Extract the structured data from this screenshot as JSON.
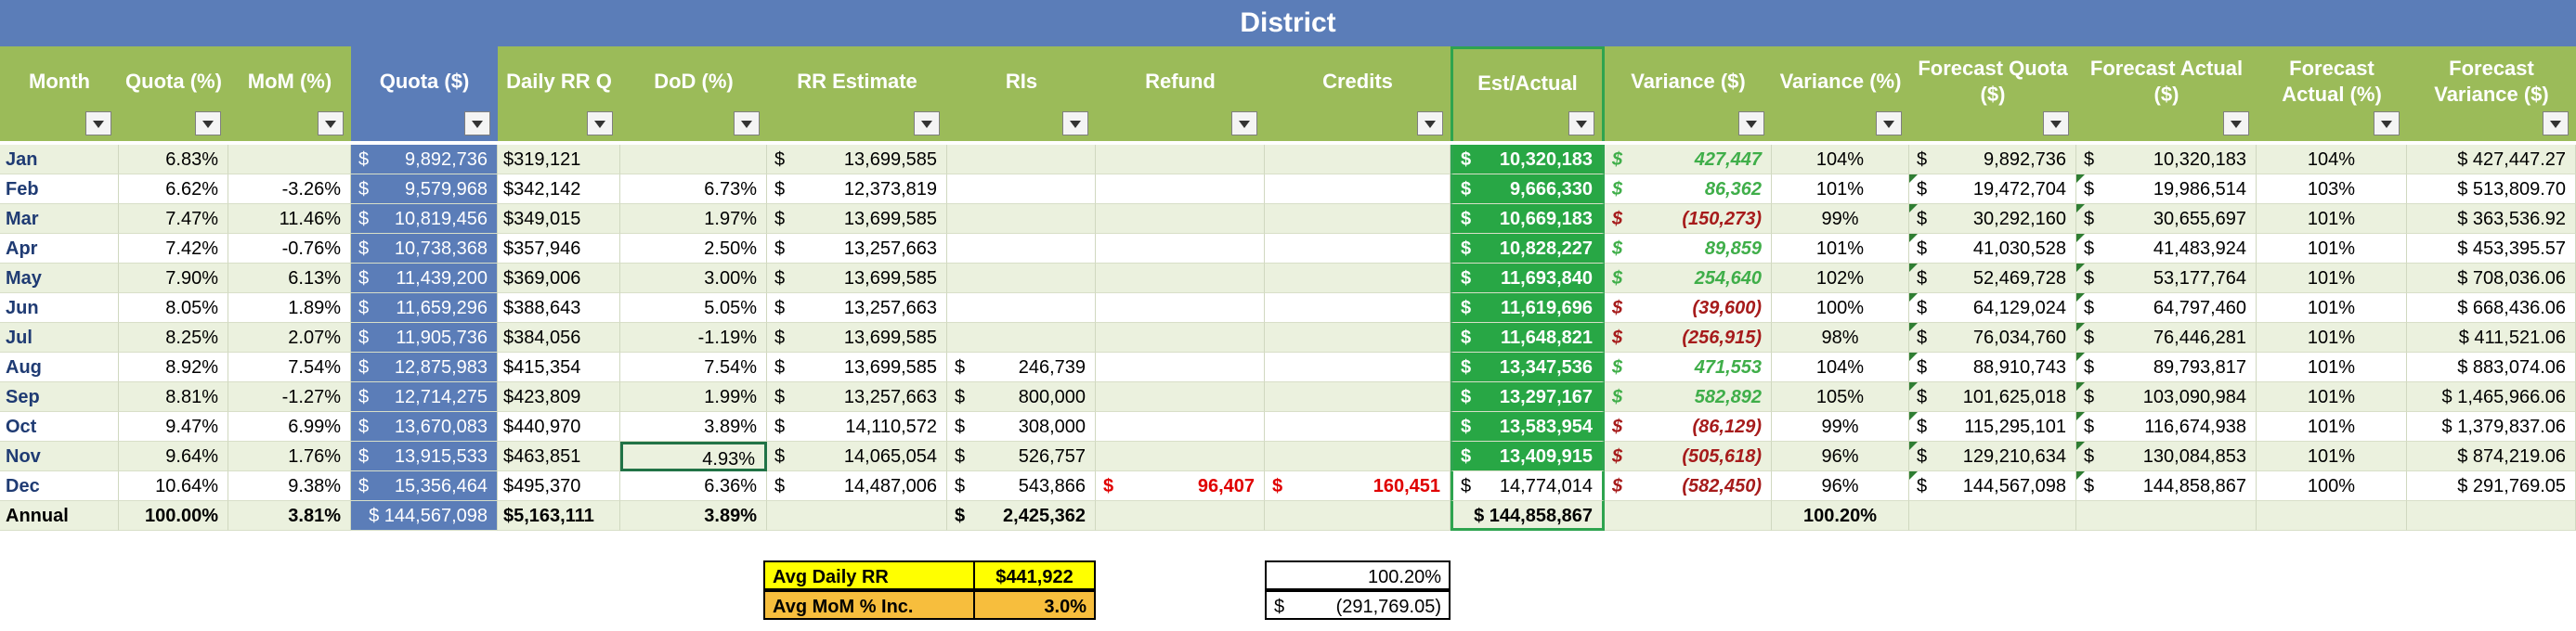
{
  "title": "District",
  "headers": {
    "month": "Month",
    "quota_pct": "Quota (%)",
    "mom": "MoM  (%)",
    "quota_dollar": "Quota ($)",
    "daily_rr": "Daily RR Q",
    "dod": "DoD (%)",
    "rr_estimate": "RR Estimate",
    "ris": "RIs",
    "refund": "Refund",
    "credits": "Credits",
    "est_actual": "Est/Actual",
    "variance_dollar": "Variance ($)",
    "variance_pct": "Variance (%)",
    "forecast_quota": "Forecast Quota ($)",
    "forecast_actual": "Forecast Actual ($)",
    "forecast_actual_pct": "Forecast Actual (%)",
    "forecast_variance": "Forecast Variance ($)"
  },
  "rows": [
    {
      "month": "Jan",
      "qp": "6.83%",
      "mom": "",
      "qd": "9,892,736",
      "drr": "$319,121",
      "dod": "",
      "rre": "13,699,585",
      "ris": "",
      "ref": "",
      "cred": "",
      "est": "10,320,183",
      "var": "427,447",
      "varneg": false,
      "vp": "104%",
      "fq": "9,892,736",
      "fa": "10,320,183",
      "fap": "104%",
      "fv": "$ 427,447.27"
    },
    {
      "month": "Feb",
      "qp": "6.62%",
      "mom": "-3.26%",
      "qd": "9,579,968",
      "drr": "$342,142",
      "dod": "6.73%",
      "rre": "12,373,819",
      "ris": "",
      "ref": "",
      "cred": "",
      "est": "9,666,330",
      "var": "86,362",
      "varneg": false,
      "vp": "101%",
      "fq": "19,472,704",
      "fa": "19,986,514",
      "fap": "103%",
      "fv": "$ 513,809.70"
    },
    {
      "month": "Mar",
      "qp": "7.47%",
      "mom": "11.46%",
      "qd": "10,819,456",
      "drr": "$349,015",
      "dod": "1.97%",
      "rre": "13,699,585",
      "ris": "",
      "ref": "",
      "cred": "",
      "est": "10,669,183",
      "var": "(150,273)",
      "varneg": true,
      "vp": "99%",
      "fq": "30,292,160",
      "fa": "30,655,697",
      "fap": "101%",
      "fv": "$ 363,536.92"
    },
    {
      "month": "Apr",
      "qp": "7.42%",
      "mom": "-0.76%",
      "qd": "10,738,368",
      "drr": "$357,946",
      "dod": "2.50%",
      "rre": "13,257,663",
      "ris": "",
      "ref": "",
      "cred": "",
      "est": "10,828,227",
      "var": "89,859",
      "varneg": false,
      "vp": "101%",
      "fq": "41,030,528",
      "fa": "41,483,924",
      "fap": "101%",
      "fv": "$ 453,395.57"
    },
    {
      "month": "May",
      "qp": "7.90%",
      "mom": "6.13%",
      "qd": "11,439,200",
      "drr": "$369,006",
      "dod": "3.00%",
      "rre": "13,699,585",
      "ris": "",
      "ref": "",
      "cred": "",
      "est": "11,693,840",
      "var": "254,640",
      "varneg": false,
      "vp": "102%",
      "fq": "52,469,728",
      "fa": "53,177,764",
      "fap": "101%",
      "fv": "$ 708,036.06"
    },
    {
      "month": "Jun",
      "qp": "8.05%",
      "mom": "1.89%",
      "qd": "11,659,296",
      "drr": "$388,643",
      "dod": "5.05%",
      "rre": "13,257,663",
      "ris": "",
      "ref": "",
      "cred": "",
      "est": "11,619,696",
      "var": "(39,600)",
      "varneg": true,
      "vp": "100%",
      "fq": "64,129,024",
      "fa": "64,797,460",
      "fap": "101%",
      "fv": "$ 668,436.06"
    },
    {
      "month": "Jul",
      "qp": "8.25%",
      "mom": "2.07%",
      "qd": "11,905,736",
      "drr": "$384,056",
      "dod": "-1.19%",
      "rre": "13,699,585",
      "ris": "",
      "ref": "",
      "cred": "",
      "est": "11,648,821",
      "var": "(256,915)",
      "varneg": true,
      "vp": "98%",
      "fq": "76,034,760",
      "fa": "76,446,281",
      "fap": "101%",
      "fv": "$ 411,521.06"
    },
    {
      "month": "Aug",
      "qp": "8.92%",
      "mom": "7.54%",
      "qd": "12,875,983",
      "drr": "$415,354",
      "dod": "7.54%",
      "rre": "13,699,585",
      "ris": "246,739",
      "ref": "",
      "cred": "",
      "est": "13,347,536",
      "var": "471,553",
      "varneg": false,
      "vp": "104%",
      "fq": "88,910,743",
      "fa": "89,793,817",
      "fap": "101%",
      "fv": "$ 883,074.06"
    },
    {
      "month": "Sep",
      "qp": "8.81%",
      "mom": "-1.27%",
      "qd": "12,714,275",
      "drr": "$423,809",
      "dod": "1.99%",
      "rre": "13,257,663",
      "ris": "800,000",
      "ref": "",
      "cred": "",
      "est": "13,297,167",
      "var": "582,892",
      "varneg": false,
      "vp": "105%",
      "fq": "101,625,018",
      "fa": "103,090,984",
      "fap": "101%",
      "fv": "$ 1,465,966.06"
    },
    {
      "month": "Oct",
      "qp": "9.47%",
      "mom": "6.99%",
      "qd": "13,670,083",
      "drr": "$440,970",
      "dod": "3.89%",
      "rre": "14,110,572",
      "ris": "308,000",
      "ref": "",
      "cred": "",
      "est": "13,583,954",
      "var": "(86,129)",
      "varneg": true,
      "vp": "99%",
      "fq": "115,295,101",
      "fa": "116,674,938",
      "fap": "101%",
      "fv": "$ 1,379,837.06"
    },
    {
      "month": "Nov",
      "qp": "9.64%",
      "mom": "1.76%",
      "qd": "13,915,533",
      "drr": "$463,851",
      "dod": "4.93%",
      "rre": "14,065,054",
      "ris": "526,757",
      "ref": "",
      "cred": "",
      "est": "13,409,915",
      "var": "(505,618)",
      "varneg": true,
      "vp": "96%",
      "fq": "129,210,634",
      "fa": "130,084,853",
      "fap": "101%",
      "fv": "$ 874,219.06"
    },
    {
      "month": "Dec",
      "qp": "10.64%",
      "mom": "9.38%",
      "qd": "15,356,464",
      "drr": "$495,370",
      "dod": "6.36%",
      "rre": "14,487,006",
      "ris": "543,866",
      "ref": "96,407",
      "cred": "160,451",
      "est": "14,774,014",
      "var": "(582,450)",
      "varneg": true,
      "vp": "96%",
      "fq": "144,567,098",
      "fa": "144,858,867",
      "fap": "100%",
      "fv": "$ 291,769.05"
    }
  ],
  "annual": {
    "month": "Annual",
    "qp": "100.00%",
    "mom": "3.81%",
    "qd": "$ 144,567,098",
    "drr": "$5,163,111",
    "dod": "3.89%",
    "ris": "2,425,362",
    "est": "$ 144,858,867",
    "vp": "100.20%"
  },
  "dollar": "$",
  "summary": {
    "avg_daily_rr_label": "Avg Daily RR",
    "avg_daily_rr_value": "$441,922",
    "avg_mom_label": "Avg MoM  % Inc.",
    "avg_mom_value": "3.0%",
    "pct_value": "100.20%",
    "dollar_sign": "$",
    "variance_value": "(291,769.05)"
  },
  "colors": {
    "title_bg": "#5B7DB8",
    "header_bg": "#9BBB59",
    "band": "#EBF1DE",
    "est_green": "#28A745",
    "positive": "#3FAE49",
    "negative": "#A61B1B",
    "refund_red": "#E00000",
    "yellow": "#FFFF00",
    "orange": "#F7BE3D"
  }
}
